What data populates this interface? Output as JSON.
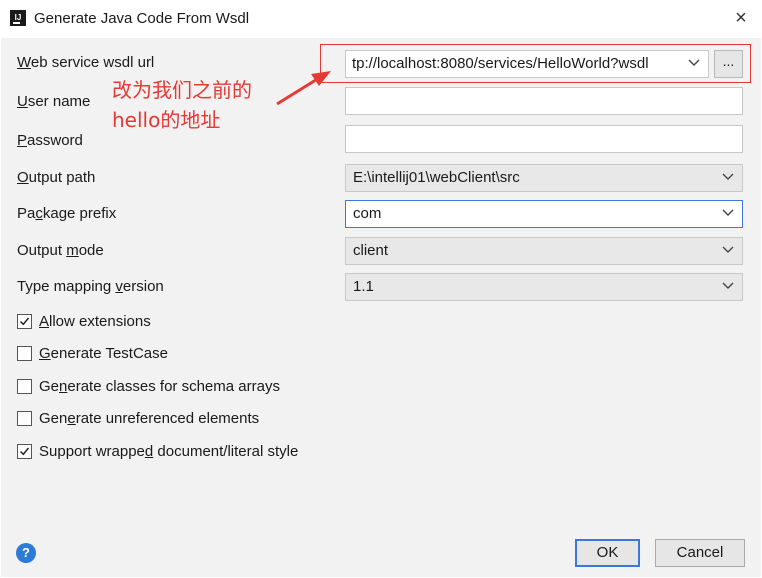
{
  "window": {
    "title": "Generate Java Code From Wsdl",
    "close_symbol": "×",
    "app_icon_text": "IJ"
  },
  "form": {
    "wsdl_url": {
      "label_pre": "",
      "label_u": "W",
      "label_post": "eb service wsdl url",
      "value": "tp://localhost:8080/services/HelloWorld?wsdl",
      "browse_label": "..."
    },
    "user_name": {
      "label_pre": "",
      "label_u": "U",
      "label_post": "ser name",
      "value": ""
    },
    "password": {
      "label_pre": "",
      "label_u": "P",
      "label_post": "assword",
      "value": ""
    },
    "output_path": {
      "label_pre": "",
      "label_u": "O",
      "label_post": "utput path",
      "value": "E:\\intellij01\\webClient\\src"
    },
    "package_prefix": {
      "label_pre": "Pa",
      "label_u": "c",
      "label_post": "kage prefix",
      "value": "com"
    },
    "output_mode": {
      "label_pre": "Output ",
      "label_u": "m",
      "label_post": "ode",
      "value": "client"
    },
    "type_mapping": {
      "label_pre": "Type mapping ",
      "label_u": "v",
      "label_post": "ersion",
      "value": "1.1"
    }
  },
  "checkboxes": [
    {
      "label_pre": "",
      "label_u": "A",
      "label_post": "llow extensions",
      "checked": true
    },
    {
      "label_pre": "",
      "label_u": "G",
      "label_post": "enerate TestCase",
      "checked": false
    },
    {
      "label_pre": "Ge",
      "label_u": "n",
      "label_post": "erate classes for schema arrays",
      "checked": false
    },
    {
      "label_pre": "Gen",
      "label_u": "e",
      "label_post": "rate unreferenced elements",
      "checked": false
    },
    {
      "label_pre": "Support wrappe",
      "label_u": "d",
      "label_post": " document/literal style",
      "checked": true
    }
  ],
  "annotation": {
    "line1": "改为我们之前的",
    "line2_pre": "hello",
    "line2_post": "的地址",
    "color": "#e53935"
  },
  "footer": {
    "help_symbol": "?",
    "ok_label": "OK",
    "cancel_label": "Cancel"
  }
}
